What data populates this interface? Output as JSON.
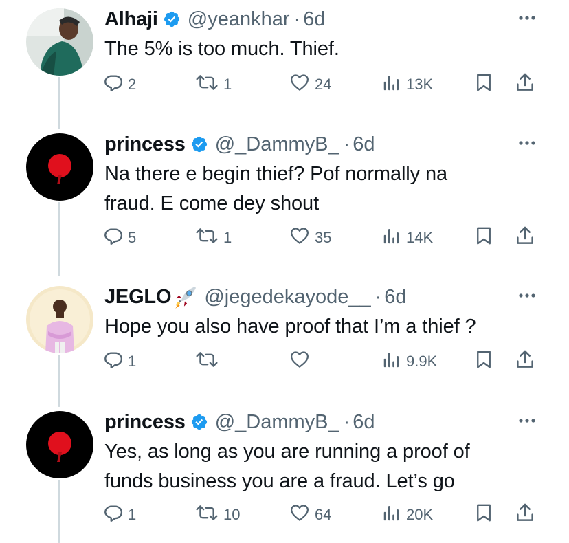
{
  "colors": {
    "verified": "#1d9bf0",
    "secondary_text": "#536471",
    "thread_line": "#cfd9de"
  },
  "icons": {
    "reply": "reply-icon",
    "retweet": "retweet-icon",
    "like": "heart-icon",
    "views": "views-chart-icon",
    "bookmark": "bookmark-icon",
    "share": "share-icon",
    "more": "more-dots-icon",
    "verified": "verified-badge-icon",
    "rocket": "rocket-emoji-icon"
  },
  "tweets": [
    {
      "name": "Alhaji",
      "handle": "@yeankhar",
      "dot": "·",
      "time": "6d",
      "lines": [
        "The 5% is too much. Thief."
      ],
      "replies": "2",
      "retweets": "1",
      "likes": "24",
      "views": "13K"
    },
    {
      "name": "princess",
      "handle": "@_DammyB_",
      "dot": "·",
      "time": "6d",
      "lines": [
        "Na there e begin thief? Pof normally na",
        "fraud. E come dey shout"
      ],
      "replies": "5",
      "retweets": "1",
      "likes": "35",
      "views": "14K"
    },
    {
      "name": "JEGLO",
      "handle": "@jegedekayode__",
      "dot": "·",
      "time": "6d",
      "lines": [
        "Hope you also have proof that I’m a thief ?"
      ],
      "replies": "1",
      "retweets": "",
      "likes": "",
      "views": "9.9K"
    },
    {
      "name": "princess",
      "handle": "@_DammyB_",
      "dot": "·",
      "time": "6d",
      "lines": [
        "Yes, as long as you are running a proof of",
        "funds business you are a fraud. Let’s go"
      ],
      "replies": "1",
      "retweets": "10",
      "likes": "64",
      "views": "20K"
    }
  ]
}
